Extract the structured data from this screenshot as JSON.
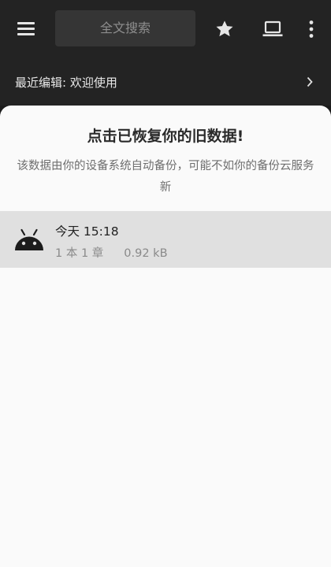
{
  "toolbar": {
    "search_placeholder": "全文搜索",
    "icons": {
      "menu": "hamburger-menu-icon",
      "favorite": "star-icon",
      "laptop": "laptop-icon",
      "more": "more-vertical-icon"
    }
  },
  "recent": {
    "label": "最近编辑: 欢迎使用"
  },
  "sheet": {
    "title": "点击已恢复你的旧数据!",
    "description": "该数据由你的设备系统自动备份，可能不如你的备份云服务新",
    "items": [
      {
        "title": "今天 15:18",
        "count": "1 本 1 章",
        "size": "0.92 kB",
        "icon": "android-icon"
      }
    ]
  },
  "colors": {
    "toolbar_bg": "#232323",
    "search_bg": "#353535",
    "sheet_bg": "#fafafa",
    "item_bg": "#e0e0e0",
    "icon_color": "#e6e6e6"
  }
}
